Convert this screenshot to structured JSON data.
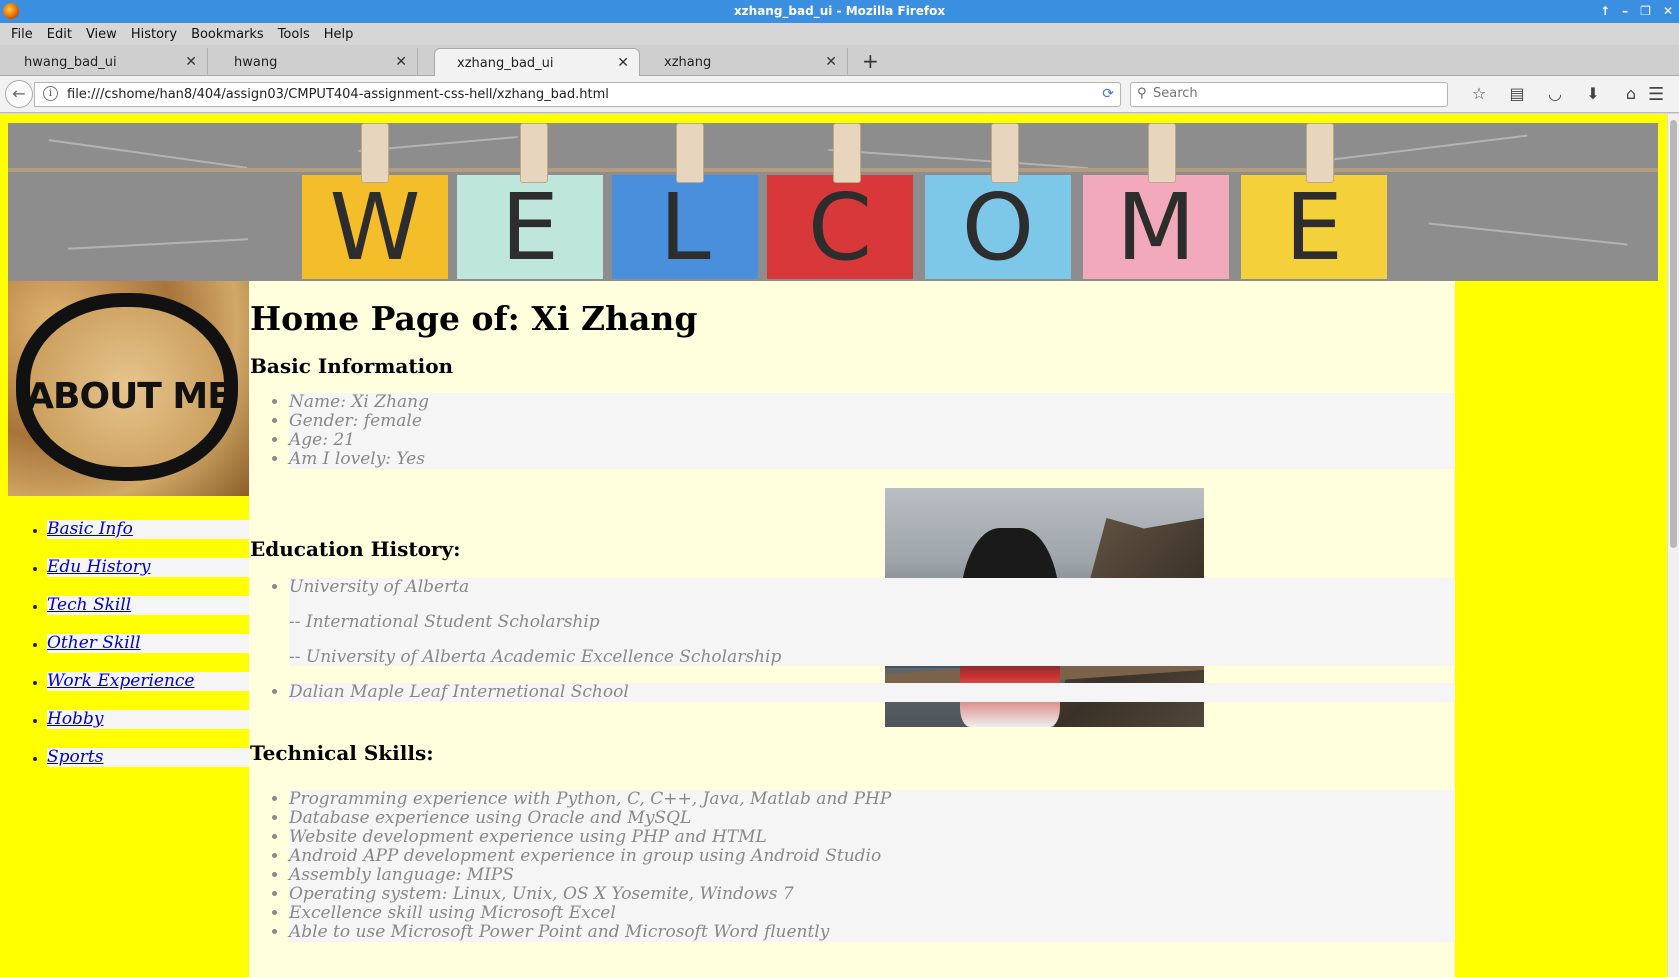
{
  "window": {
    "title": "xzhang_bad_ui - Mozilla Firefox",
    "controls": [
      "↑",
      "–",
      "❐",
      "✕"
    ]
  },
  "menu": [
    "File",
    "Edit",
    "View",
    "History",
    "Bookmarks",
    "Tools",
    "Help"
  ],
  "tabs": [
    {
      "label": "hwang_bad_ui",
      "active": false
    },
    {
      "label": "hwang",
      "active": false
    },
    {
      "label": "xzhang_bad_ui",
      "active": true
    },
    {
      "label": "xzhang",
      "active": false
    }
  ],
  "toolbar": {
    "url": "file:///cshome/han8/404/assign03/CMPUT404-assignment-css-hell/xzhang_bad.html",
    "search_placeholder": "Search",
    "icons": [
      "bookmark-star-icon",
      "reader-list-icon",
      "pocket-icon",
      "download-icon",
      "home-icon"
    ]
  },
  "banner": {
    "letters": [
      "W",
      "E",
      "L",
      "C",
      "O",
      "M",
      "E"
    ],
    "colors": [
      "#f4bd2a",
      "#bfe6da",
      "#4a8fdc",
      "#d8383a",
      "#7dc8e8",
      "#f2a9bb",
      "#f4d03a"
    ]
  },
  "about_label": "ABOUT ME",
  "nav": [
    "Basic Info",
    "Edu History",
    "Tech Skill",
    "Other Skill",
    "Work Experience",
    "Hobby",
    "Sports"
  ],
  "page": {
    "title": "Home Page of: Xi Zhang",
    "basic_heading": "Basic Information",
    "basic": [
      "Name: Xi Zhang",
      "Gender: female",
      "Age: 21",
      "Am I lovely: Yes"
    ],
    "edu_heading": "Education History:",
    "edu": {
      "uni": "University of Alberta",
      "sch1": "-- International Student Scholarship",
      "sch2": "-- University of Alberta Academic Excellence Scholarship",
      "school2": "Dalian Maple Leaf Internetional School"
    },
    "tech_heading": "Technical Skills:",
    "tech": [
      "Programming experience with Python, C, C++, Java, Matlab and PHP",
      "Database experience using Oracle and MySQL",
      "Website development experience using PHP and HTML",
      "Android APP development experience in group using Android Studio",
      "Assembly language: MIPS",
      "Operating system: Linux, Unix, OS X Yosemite, Windows 7",
      "Excellence skill using Microsoft Excel",
      "Able to use Microsoft Power Point and Microsoft Word fluently"
    ]
  }
}
